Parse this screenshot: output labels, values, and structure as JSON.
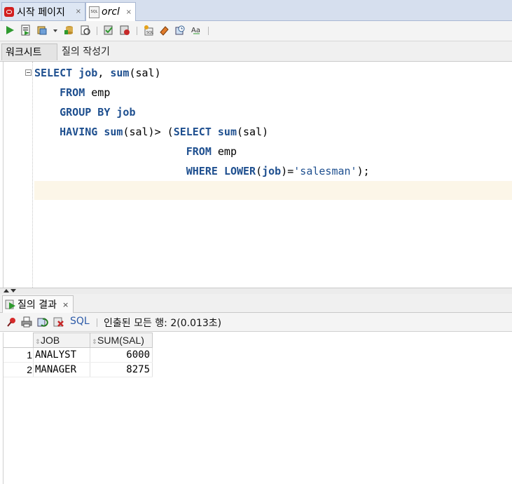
{
  "tabs": [
    {
      "label": "시작 페이지",
      "close": "×"
    },
    {
      "label": "orcl",
      "close": "×"
    }
  ],
  "subtabs": {
    "worksheet": "워크시트",
    "query_builder": "질의 작성기"
  },
  "editor": {
    "lines": [
      {
        "indent": "",
        "tokens": [
          [
            "kw",
            "SELECT"
          ],
          [
            "pl",
            " "
          ],
          [
            "kw",
            "job"
          ],
          [
            "pl",
            ", "
          ],
          [
            "kw",
            "sum"
          ],
          [
            "pl",
            "(sal)"
          ]
        ]
      },
      {
        "indent": "    ",
        "tokens": [
          [
            "kw",
            "FROM"
          ],
          [
            "pl",
            " emp"
          ]
        ]
      },
      {
        "indent": "    ",
        "tokens": [
          [
            "kw",
            "GROUP BY"
          ],
          [
            "pl",
            " "
          ],
          [
            "kw",
            "job"
          ]
        ]
      },
      {
        "indent": "    ",
        "tokens": [
          [
            "kw",
            "HAVING"
          ],
          [
            "pl",
            " "
          ],
          [
            "kw",
            "sum"
          ],
          [
            "pl",
            "(sal)> ("
          ],
          [
            "kw",
            "SELECT"
          ],
          [
            "pl",
            " "
          ],
          [
            "kw",
            "sum"
          ],
          [
            "pl",
            "(sal)"
          ]
        ]
      },
      {
        "indent": "                        ",
        "tokens": [
          [
            "kw",
            "FROM"
          ],
          [
            "pl",
            " emp"
          ]
        ]
      },
      {
        "indent": "                        ",
        "tokens": [
          [
            "kw",
            "WHERE"
          ],
          [
            "pl",
            " "
          ],
          [
            "kw",
            "LOWER"
          ],
          [
            "pl",
            "("
          ],
          [
            "kw",
            "job"
          ],
          [
            "pl",
            ")="
          ],
          [
            "str",
            "'salesman'"
          ],
          [
            "pl",
            ");"
          ]
        ]
      }
    ]
  },
  "results": {
    "tab_label": "질의 결과",
    "tab_close": "×",
    "sql_link": "SQL",
    "status": "인출된 모든 행: 2(0.013초)",
    "columns": [
      "JOB",
      "SUM(SAL)"
    ],
    "rows": [
      {
        "n": "1",
        "job": "ANALYST",
        "sum": "6000"
      },
      {
        "n": "2",
        "job": "MANAGER",
        "sum": "8275"
      }
    ]
  },
  "colors": {
    "keyword": "#1e4f8f",
    "current_line": "#fcf6e8",
    "tabbar": "#d6dfee"
  }
}
